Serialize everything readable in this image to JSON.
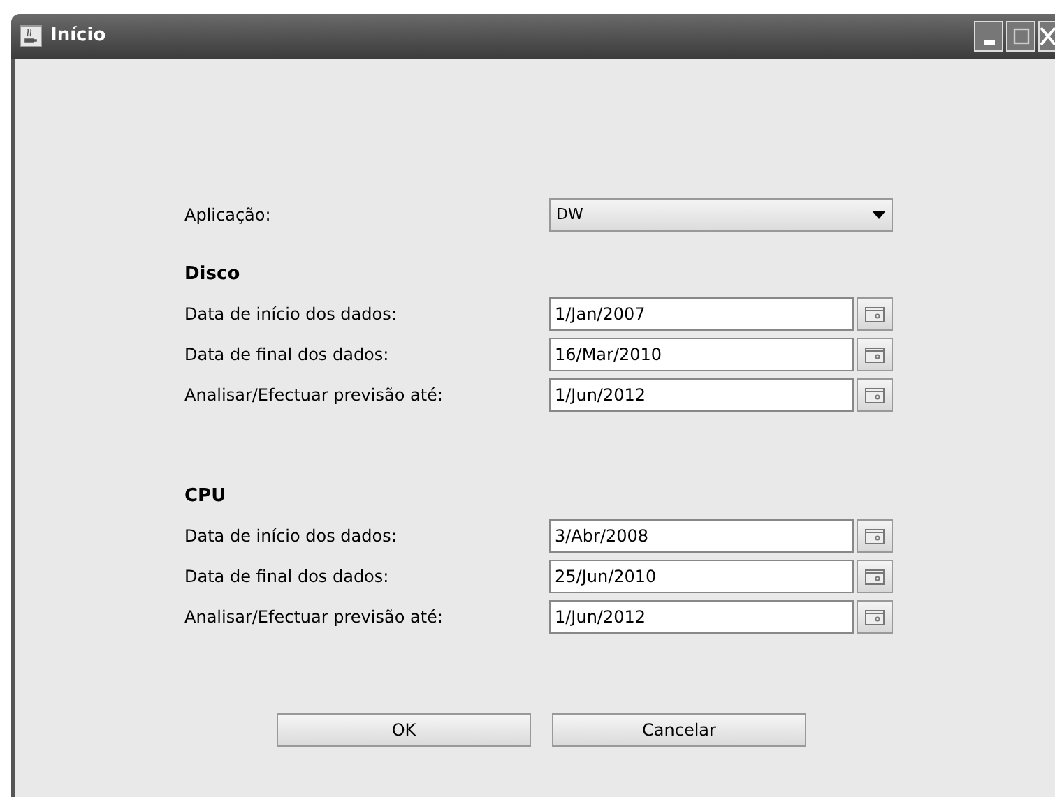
{
  "window": {
    "title": "Início"
  },
  "application": {
    "label": "Aplicação:",
    "value": "DW"
  },
  "sections": [
    {
      "heading": "Disco",
      "rows": [
        {
          "label": "Data de início dos dados:",
          "value": "1/Jan/2007"
        },
        {
          "label": "Data de final dos dados:",
          "value": "16/Mar/2010"
        },
        {
          "label": "Analisar/Efectuar previsão até:",
          "value": "1/Jun/2012"
        }
      ]
    },
    {
      "heading": "CPU",
      "rows": [
        {
          "label": "Data de início dos dados:",
          "value": "3/Abr/2008"
        },
        {
          "label": "Data de final dos dados:",
          "value": "25/Jun/2010"
        },
        {
          "label": "Analisar/Efectuar previsão até:",
          "value": "1/Jun/2012"
        }
      ]
    }
  ],
  "buttons": [
    "OK",
    "Cancelar"
  ]
}
